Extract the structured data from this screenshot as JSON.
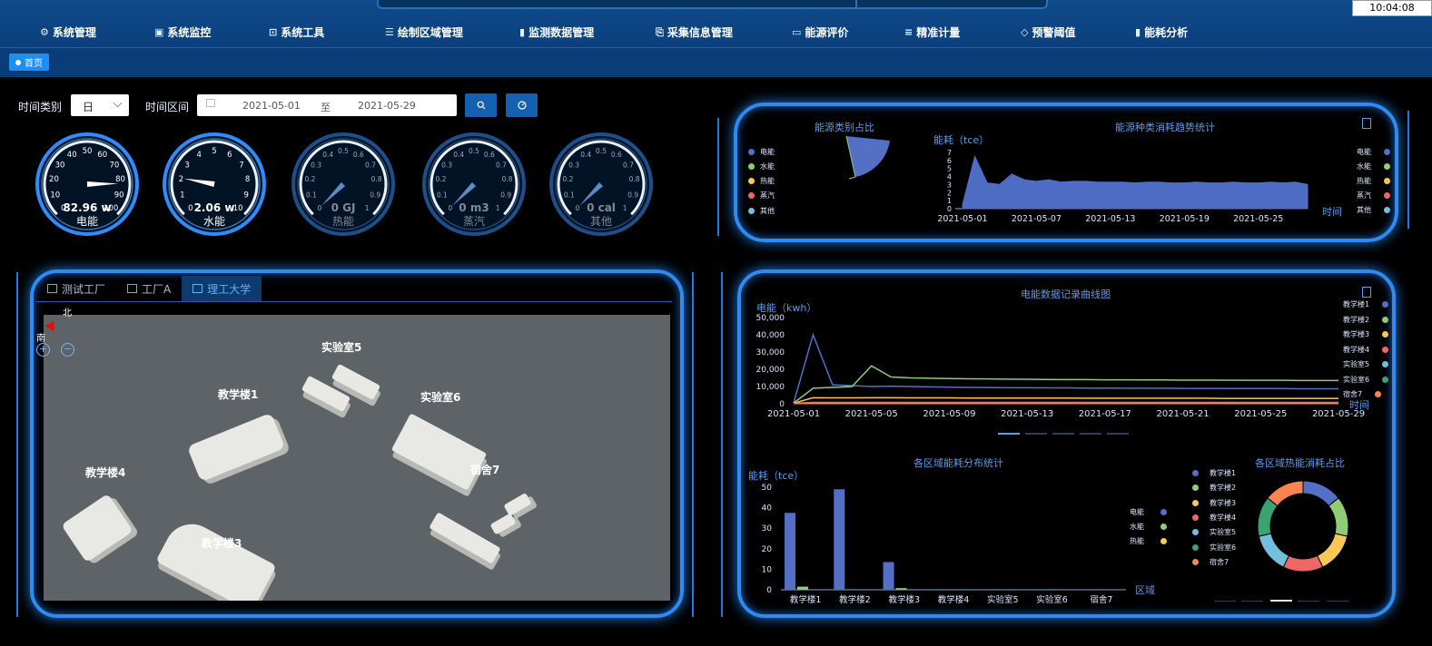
{
  "header": {
    "clock": "10:04:08",
    "nav": [
      {
        "label": "系统管理",
        "icon": "⚙"
      },
      {
        "label": "系统监控",
        "icon": "▣"
      },
      {
        "label": "系统工具",
        "icon": "⊡"
      },
      {
        "label": "绘制区域管理",
        "icon": "☰"
      },
      {
        "label": "监测数据管理",
        "icon": "▮"
      },
      {
        "label": "采集信息管理",
        "icon": "⎘"
      },
      {
        "label": "能源评价",
        "icon": "▭"
      },
      {
        "label": "精准计量",
        "icon": "≡"
      },
      {
        "label": "预警阈值",
        "icon": "◇"
      },
      {
        "label": "能耗分析",
        "icon": "▮"
      }
    ]
  },
  "breadcrumb": {
    "home": "首页"
  },
  "filters": {
    "time_type_label": "时间类别",
    "time_type_value": "日",
    "time_range_label": "时间区间",
    "start": "2021-05-01",
    "sep": "至",
    "end": "2021-05-29",
    "search_icon": "search-icon",
    "reset_icon": "dashboard-icon"
  },
  "gauges": [
    {
      "name": "电能",
      "value": 82.96,
      "unit": "w",
      "display": "82.96 w",
      "max": 100,
      "ticks": [
        "0",
        "10",
        "20",
        "30",
        "40",
        "50",
        "60",
        "70",
        "80",
        "90",
        "100"
      ],
      "color": "#2f8cff"
    },
    {
      "name": "水能",
      "value": 2.06,
      "unit": "w",
      "display": "2.06 w",
      "max": 10,
      "ticks": [
        "0",
        "1",
        "2",
        "3",
        "4",
        "5",
        "6",
        "7",
        "8",
        "9",
        "10"
      ],
      "color": "#2f8cff"
    },
    {
      "name": "热能",
      "value": 0,
      "unit": "GJ",
      "display": "0 GJ",
      "max": 1,
      "ticks": [
        "0",
        "0.1",
        "0.2",
        "0.3",
        "0.4",
        "0.5",
        "0.6",
        "0.7",
        "0.8",
        "0.9",
        "1"
      ],
      "color": "#2a5a9a"
    },
    {
      "name": "蒸汽",
      "value": 0,
      "unit": "m3",
      "display": "0 m3",
      "max": 1,
      "ticks": [
        "0",
        "0.1",
        "0.2",
        "0.3",
        "0.4",
        "0.5",
        "0.6",
        "0.7",
        "0.8",
        "0.9",
        "1"
      ],
      "color": "#2a5a9a"
    },
    {
      "name": "其他",
      "value": 0,
      "unit": "cal",
      "display": "0 cal",
      "max": 1,
      "ticks": [
        "0",
        "0.1",
        "0.2",
        "0.3",
        "0.4",
        "0.5",
        "0.6",
        "0.7",
        "0.8",
        "0.9",
        "1"
      ],
      "color": "#2a5a9a"
    }
  ],
  "energy_types": {
    "title": "能源类别占比",
    "legend": [
      {
        "name": "电能",
        "color": "#5470c6"
      },
      {
        "name": "水能",
        "color": "#91cc75"
      },
      {
        "name": "热能",
        "color": "#fac858"
      },
      {
        "name": "蒸汽",
        "color": "#ee6666"
      },
      {
        "name": "其他",
        "color": "#73c0de"
      }
    ]
  },
  "map": {
    "tabs": [
      {
        "label": "测试工厂",
        "icon": "calendar-icon"
      },
      {
        "label": "工厂A",
        "icon": "calendar-icon"
      },
      {
        "label": "理工大学",
        "icon": "calendar-icon"
      }
    ],
    "compass_north": "北",
    "compass_south": "南",
    "zoom_in": "+",
    "zoom_out": "−",
    "buildings": [
      "实验室5",
      "教学楼1",
      "实验室6",
      "教学楼4",
      "宿舍7",
      "教学楼3"
    ]
  },
  "chart_data": [
    {
      "type": "pie",
      "title": "能源类别占比",
      "categories": [
        "电能",
        "水能",
        "热能",
        "蒸汽",
        "其他"
      ],
      "values": [
        97,
        3,
        0,
        0,
        0
      ],
      "rose": true
    },
    {
      "type": "area",
      "title": "能源种类消耗趋势统计",
      "ylabel": "能耗（tce）",
      "xlabel": "时间",
      "ylim": [
        0,
        7
      ],
      "yticks": [
        "0",
        "1",
        "2",
        "3",
        "4",
        "5",
        "6",
        "7"
      ],
      "x": [
        "2021-05-01",
        "2021-05-02",
        "2021-05-03",
        "2021-05-04",
        "2021-05-05",
        "2021-05-06",
        "2021-05-07",
        "2021-05-08",
        "2021-05-09",
        "2021-05-10",
        "2021-05-11",
        "2021-05-12",
        "2021-05-13",
        "2021-05-14",
        "2021-05-15",
        "2021-05-16",
        "2021-05-17",
        "2021-05-18",
        "2021-05-19",
        "2021-05-20",
        "2021-05-21",
        "2021-05-22",
        "2021-05-23",
        "2021-05-24",
        "2021-05-25",
        "2021-05-26",
        "2021-05-27",
        "2021-05-28",
        "2021-05-29"
      ],
      "xticks": [
        "2021-05-01",
        "2021-05-07",
        "2021-05-13",
        "2021-05-19",
        "2021-05-25"
      ],
      "series": [
        {
          "name": "电能",
          "values": [
            0.5,
            6.5,
            3.2,
            3.0,
            4.3,
            3.6,
            3.4,
            3.6,
            3.3,
            3.4,
            3.4,
            3.3,
            3.3,
            3.3,
            3.2,
            3.3,
            3.3,
            3.2,
            3.2,
            3.3,
            3.2,
            3.2,
            3.3,
            3.2,
            3.2,
            3.3,
            3.2,
            3.3,
            3.0
          ]
        }
      ],
      "legend": [
        "电能",
        "水能",
        "热能",
        "蒸汽",
        "其他"
      ]
    },
    {
      "type": "line",
      "title": "电能数据记录曲线图",
      "ylabel": "电能（kwh）",
      "xlabel": "时间",
      "ylim": [
        0,
        50000
      ],
      "yticks": [
        "0",
        "10,000",
        "20,000",
        "30,000",
        "40,000",
        "50,000"
      ],
      "x": [
        "2021-05-01",
        "2021-05-02",
        "2021-05-03",
        "2021-05-04",
        "2021-05-05",
        "2021-05-06",
        "2021-05-07",
        "2021-05-08",
        "2021-05-09",
        "2021-05-10",
        "2021-05-11",
        "2021-05-12",
        "2021-05-13",
        "2021-05-14",
        "2021-05-15",
        "2021-05-16",
        "2021-05-17",
        "2021-05-18",
        "2021-05-19",
        "2021-05-20",
        "2021-05-21",
        "2021-05-22",
        "2021-05-23",
        "2021-05-24",
        "2021-05-25",
        "2021-05-26",
        "2021-05-27",
        "2021-05-28",
        "2021-05-29"
      ],
      "xticks": [
        "2021-05-01",
        "2021-05-05",
        "2021-05-09",
        "2021-05-13",
        "2021-05-17",
        "2021-05-21",
        "2021-05-25",
        "2021-05-29"
      ],
      "series": [
        {
          "name": "教学楼1",
          "color": "#5470c6",
          "values": [
            500,
            40000,
            11000,
            10500,
            10000,
            10200,
            10000,
            9800,
            9600,
            9500,
            9400,
            9300,
            9300,
            9200,
            9200,
            9100,
            9100,
            9000,
            9000,
            9000,
            8900,
            8900,
            8900,
            8800,
            8800,
            8800,
            8700,
            8700,
            8700
          ]
        },
        {
          "name": "教学楼2",
          "color": "#91cc75",
          "values": [
            400,
            9000,
            9500,
            10000,
            22000,
            15500,
            15000,
            14800,
            14600,
            14500,
            14400,
            14300,
            14200,
            14100,
            14000,
            14000,
            13900,
            13900,
            13800,
            13800,
            13700,
            13700,
            13700,
            13600,
            13600,
            13600,
            13500,
            13500,
            13500
          ]
        },
        {
          "name": "教学楼3",
          "color": "#fac858",
          "values": [
            300,
            3500,
            3400,
            3400,
            3500,
            3500,
            3400,
            3400,
            3400,
            3300,
            3300,
            3300,
            3300,
            3300,
            3300,
            3200,
            3200,
            3200,
            3200,
            3200,
            3200,
            3200,
            3100,
            3100,
            3100,
            3100,
            3100,
            3100,
            3100
          ]
        },
        {
          "name": "教学楼4",
          "color": "#ee6666",
          "values": [
            200,
            800,
            800,
            800,
            800,
            800,
            800,
            800,
            800,
            800,
            800,
            800,
            800,
            800,
            800,
            800,
            800,
            800,
            800,
            800,
            800,
            800,
            800,
            800,
            800,
            800,
            800,
            800,
            800
          ]
        },
        {
          "name": "实验室5",
          "color": "#73c0de",
          "values": [
            100,
            300,
            300,
            300,
            300,
            300,
            300,
            300,
            300,
            300,
            300,
            300,
            300,
            300,
            300,
            300,
            300,
            300,
            300,
            300,
            300,
            300,
            300,
            300,
            300,
            300,
            300,
            300,
            300
          ]
        },
        {
          "name": "实验室6",
          "color": "#3ba272",
          "values": [
            100,
            200,
            200,
            200,
            200,
            200,
            200,
            200,
            200,
            200,
            200,
            200,
            200,
            200,
            200,
            200,
            200,
            200,
            200,
            200,
            200,
            200,
            200,
            200,
            200,
            200,
            200,
            200,
            200
          ]
        },
        {
          "name": "宿舍7",
          "color": "#fc8452",
          "values": [
            100,
            150,
            150,
            150,
            150,
            150,
            150,
            150,
            150,
            150,
            150,
            150,
            150,
            150,
            150,
            150,
            150,
            150,
            150,
            150,
            150,
            150,
            150,
            150,
            150,
            150,
            150,
            150,
            150
          ]
        }
      ]
    },
    {
      "type": "bar",
      "title": "各区域能耗分布统计",
      "ylabel": "能耗（tce）",
      "xlabel": "区域",
      "ylim": [
        0,
        50
      ],
      "yticks": [
        "0",
        "10",
        "20",
        "30",
        "40",
        "50"
      ],
      "categories": [
        "教学楼1",
        "教学楼2",
        "教学楼3",
        "教学楼4",
        "实验室5",
        "实验室6",
        "宿舍7"
      ],
      "series": [
        {
          "name": "电能",
          "color": "#5470c6",
          "values": [
            37.5,
            49,
            13.5,
            0,
            0,
            0,
            0
          ]
        },
        {
          "name": "水能",
          "color": "#91cc75",
          "values": [
            1.5,
            0,
            0.8,
            0,
            0,
            0,
            0
          ]
        },
        {
          "name": "热能",
          "color": "#fac858",
          "values": [
            0,
            0,
            0,
            0,
            0,
            0,
            0
          ]
        }
      ]
    },
    {
      "type": "pie",
      "title": "各区域热能消耗占比",
      "donut": true,
      "categories": [
        "教学楼1",
        "教学楼2",
        "教学楼3",
        "教学楼4",
        "实验室5",
        "实验室6",
        "宿舍7"
      ],
      "values": [
        1,
        1,
        1,
        1,
        1,
        1,
        1
      ],
      "colors": [
        "#5470c6",
        "#91cc75",
        "#fac858",
        "#ee6666",
        "#73c0de",
        "#3ba272",
        "#fc8452"
      ]
    }
  ]
}
